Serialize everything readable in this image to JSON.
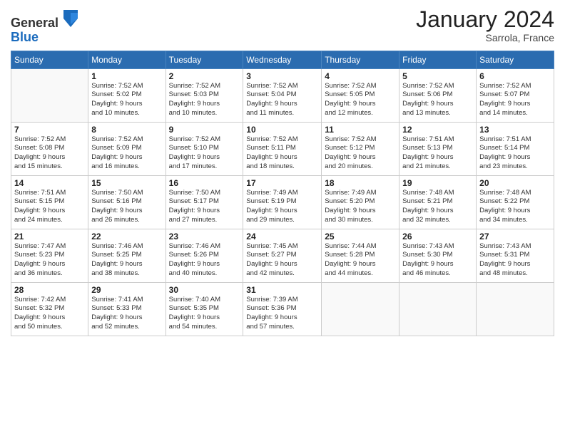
{
  "logo": {
    "general": "General",
    "blue": "Blue"
  },
  "header": {
    "month": "January 2024",
    "location": "Sarrola, France"
  },
  "weekdays": [
    "Sunday",
    "Monday",
    "Tuesday",
    "Wednesday",
    "Thursday",
    "Friday",
    "Saturday"
  ],
  "weeks": [
    [
      {
        "day": "",
        "info": ""
      },
      {
        "day": "1",
        "info": "Sunrise: 7:52 AM\nSunset: 5:02 PM\nDaylight: 9 hours\nand 10 minutes."
      },
      {
        "day": "2",
        "info": "Sunrise: 7:52 AM\nSunset: 5:03 PM\nDaylight: 9 hours\nand 10 minutes."
      },
      {
        "day": "3",
        "info": "Sunrise: 7:52 AM\nSunset: 5:04 PM\nDaylight: 9 hours\nand 11 minutes."
      },
      {
        "day": "4",
        "info": "Sunrise: 7:52 AM\nSunset: 5:05 PM\nDaylight: 9 hours\nand 12 minutes."
      },
      {
        "day": "5",
        "info": "Sunrise: 7:52 AM\nSunset: 5:06 PM\nDaylight: 9 hours\nand 13 minutes."
      },
      {
        "day": "6",
        "info": "Sunrise: 7:52 AM\nSunset: 5:07 PM\nDaylight: 9 hours\nand 14 minutes."
      }
    ],
    [
      {
        "day": "7",
        "info": "Sunrise: 7:52 AM\nSunset: 5:08 PM\nDaylight: 9 hours\nand 15 minutes."
      },
      {
        "day": "8",
        "info": "Sunrise: 7:52 AM\nSunset: 5:09 PM\nDaylight: 9 hours\nand 16 minutes."
      },
      {
        "day": "9",
        "info": "Sunrise: 7:52 AM\nSunset: 5:10 PM\nDaylight: 9 hours\nand 17 minutes."
      },
      {
        "day": "10",
        "info": "Sunrise: 7:52 AM\nSunset: 5:11 PM\nDaylight: 9 hours\nand 18 minutes."
      },
      {
        "day": "11",
        "info": "Sunrise: 7:52 AM\nSunset: 5:12 PM\nDaylight: 9 hours\nand 20 minutes."
      },
      {
        "day": "12",
        "info": "Sunrise: 7:51 AM\nSunset: 5:13 PM\nDaylight: 9 hours\nand 21 minutes."
      },
      {
        "day": "13",
        "info": "Sunrise: 7:51 AM\nSunset: 5:14 PM\nDaylight: 9 hours\nand 23 minutes."
      }
    ],
    [
      {
        "day": "14",
        "info": "Sunrise: 7:51 AM\nSunset: 5:15 PM\nDaylight: 9 hours\nand 24 minutes."
      },
      {
        "day": "15",
        "info": "Sunrise: 7:50 AM\nSunset: 5:16 PM\nDaylight: 9 hours\nand 26 minutes."
      },
      {
        "day": "16",
        "info": "Sunrise: 7:50 AM\nSunset: 5:17 PM\nDaylight: 9 hours\nand 27 minutes."
      },
      {
        "day": "17",
        "info": "Sunrise: 7:49 AM\nSunset: 5:19 PM\nDaylight: 9 hours\nand 29 minutes."
      },
      {
        "day": "18",
        "info": "Sunrise: 7:49 AM\nSunset: 5:20 PM\nDaylight: 9 hours\nand 30 minutes."
      },
      {
        "day": "19",
        "info": "Sunrise: 7:48 AM\nSunset: 5:21 PM\nDaylight: 9 hours\nand 32 minutes."
      },
      {
        "day": "20",
        "info": "Sunrise: 7:48 AM\nSunset: 5:22 PM\nDaylight: 9 hours\nand 34 minutes."
      }
    ],
    [
      {
        "day": "21",
        "info": "Sunrise: 7:47 AM\nSunset: 5:23 PM\nDaylight: 9 hours\nand 36 minutes."
      },
      {
        "day": "22",
        "info": "Sunrise: 7:46 AM\nSunset: 5:25 PM\nDaylight: 9 hours\nand 38 minutes."
      },
      {
        "day": "23",
        "info": "Sunrise: 7:46 AM\nSunset: 5:26 PM\nDaylight: 9 hours\nand 40 minutes."
      },
      {
        "day": "24",
        "info": "Sunrise: 7:45 AM\nSunset: 5:27 PM\nDaylight: 9 hours\nand 42 minutes."
      },
      {
        "day": "25",
        "info": "Sunrise: 7:44 AM\nSunset: 5:28 PM\nDaylight: 9 hours\nand 44 minutes."
      },
      {
        "day": "26",
        "info": "Sunrise: 7:43 AM\nSunset: 5:30 PM\nDaylight: 9 hours\nand 46 minutes."
      },
      {
        "day": "27",
        "info": "Sunrise: 7:43 AM\nSunset: 5:31 PM\nDaylight: 9 hours\nand 48 minutes."
      }
    ],
    [
      {
        "day": "28",
        "info": "Sunrise: 7:42 AM\nSunset: 5:32 PM\nDaylight: 9 hours\nand 50 minutes."
      },
      {
        "day": "29",
        "info": "Sunrise: 7:41 AM\nSunset: 5:33 PM\nDaylight: 9 hours\nand 52 minutes."
      },
      {
        "day": "30",
        "info": "Sunrise: 7:40 AM\nSunset: 5:35 PM\nDaylight: 9 hours\nand 54 minutes."
      },
      {
        "day": "31",
        "info": "Sunrise: 7:39 AM\nSunset: 5:36 PM\nDaylight: 9 hours\nand 57 minutes."
      },
      {
        "day": "",
        "info": ""
      },
      {
        "day": "",
        "info": ""
      },
      {
        "day": "",
        "info": ""
      }
    ]
  ]
}
